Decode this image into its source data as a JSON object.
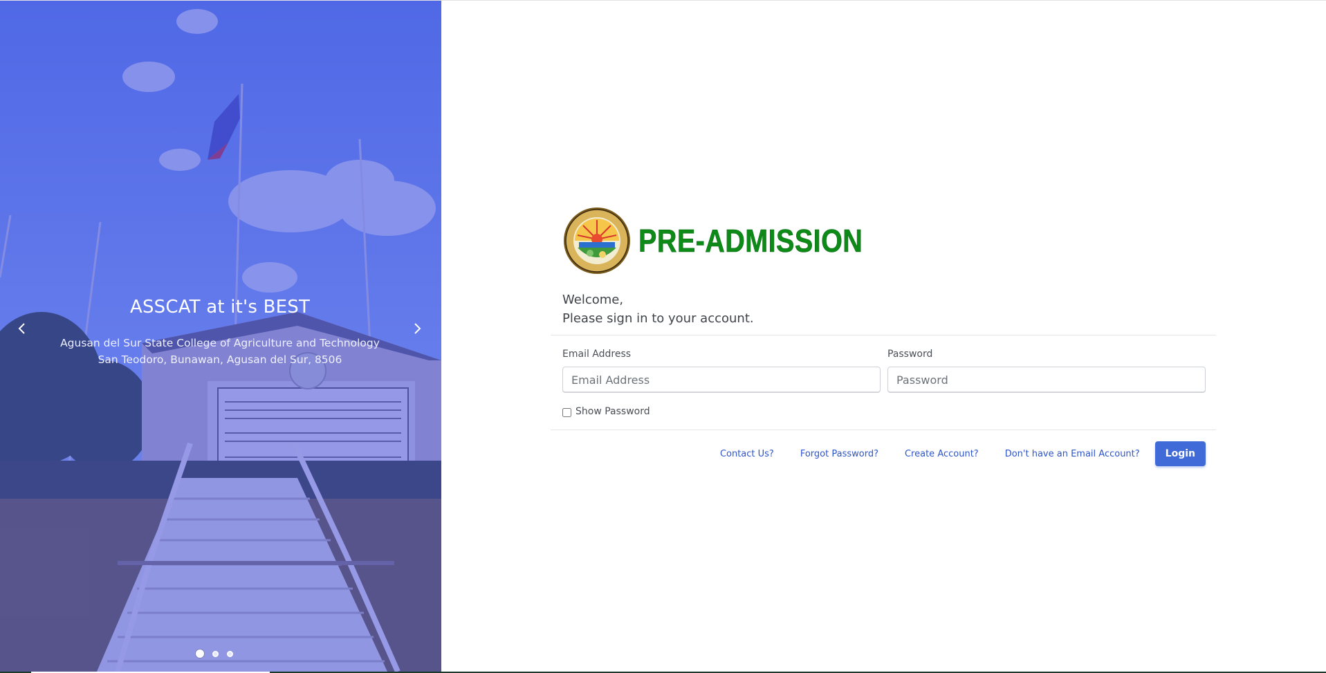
{
  "carousel": {
    "caption_title": "ASSCAT at it's BEST",
    "caption_line1": "Agusan del Sur State College of Agriculture and Technology",
    "caption_line2": "San Teodoro, Bunawan, Agusan del Sur, 8506",
    "slide_count": 3,
    "active_slide": 1,
    "overlay_color": "#4650dc"
  },
  "brand": {
    "title": "PRE-ADMISSION",
    "title_color": "#0e8a18"
  },
  "welcome": {
    "line1": "Welcome,",
    "line2": "Please sign in to your account."
  },
  "form": {
    "email_label": "Email Address",
    "email_placeholder": "Email Address",
    "email_value": "",
    "password_label": "Password",
    "password_placeholder": "Password",
    "password_value": "",
    "show_password_label": "Show Password",
    "show_password_checked": false
  },
  "links": {
    "contact": "Contact Us?",
    "forgot": "Forgot Password?",
    "create": "Create Account?",
    "no_email": "Don't have an Email Account?"
  },
  "login_button": {
    "label": "Login",
    "color": "#3f6ad8"
  }
}
